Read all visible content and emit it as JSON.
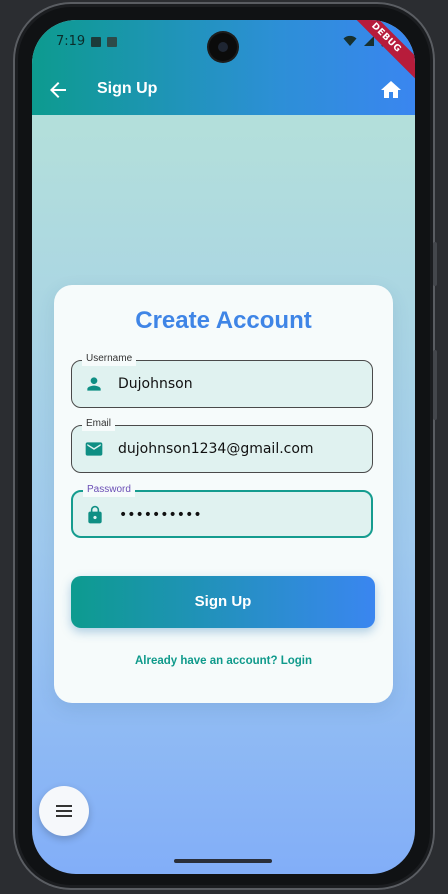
{
  "status_bar": {
    "time": "7:19",
    "debug_banner": "DEBUG"
  },
  "app_bar": {
    "title": "Sign Up",
    "back_icon": "arrow-back-icon",
    "home_icon": "home-icon"
  },
  "form": {
    "heading": "Create Account",
    "username": {
      "label": "Username",
      "value": "Dujohnson",
      "icon": "person-icon"
    },
    "email": {
      "label": "Email",
      "value": "dujohnson1234@gmail.com",
      "icon": "mail-icon"
    },
    "password": {
      "label": "Password",
      "value": "••••••••••",
      "icon": "lock-icon"
    },
    "submit_label": "Sign Up",
    "login_link": "Already have an account? Login"
  },
  "fab": {
    "icon": "menu-icon"
  },
  "colors": {
    "accent_teal": "#0d9b8f",
    "accent_blue": "#3a86f0",
    "heading_blue": "#3f85e6"
  }
}
